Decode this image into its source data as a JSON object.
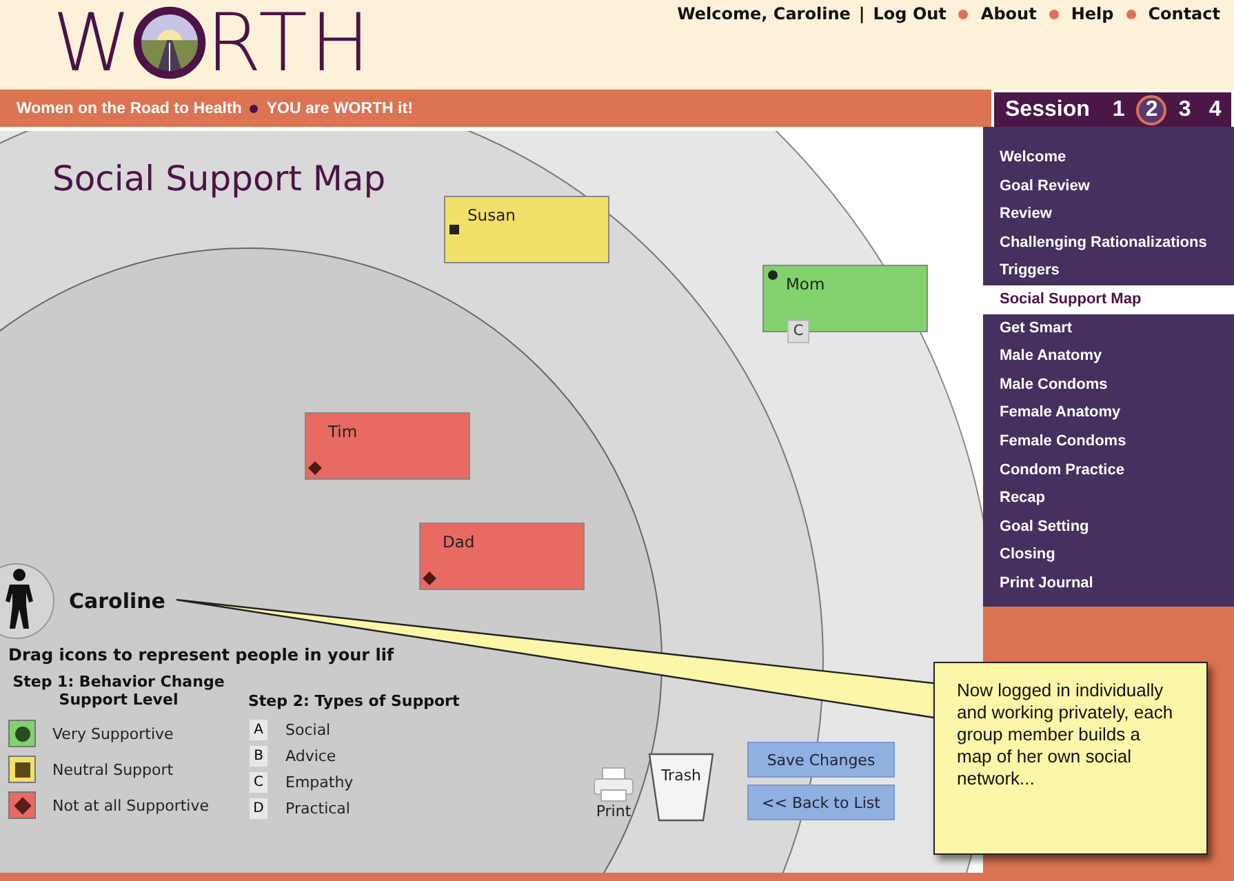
{
  "logo": {
    "before": "W",
    "after": "RTH"
  },
  "top_links": [
    {
      "kind": "text",
      "label": "Welcome, Caroline"
    },
    {
      "kind": "sep",
      "label": "|"
    },
    {
      "kind": "link",
      "label": "Log Out"
    },
    {
      "kind": "link",
      "label": "About"
    },
    {
      "kind": "link",
      "label": "Help"
    },
    {
      "kind": "link",
      "label": "Contact"
    }
  ],
  "tagline": [
    "Women on the Road to Health",
    "YOU are WORTH it!"
  ],
  "session": {
    "label": "Session",
    "numbers": [
      {
        "label": "1",
        "selected": false
      },
      {
        "label": "2",
        "selected": true
      },
      {
        "label": "3",
        "selected": false
      },
      {
        "label": "4",
        "selected": false
      }
    ]
  },
  "page_title": "Social Support Map",
  "people": [
    {
      "name": "Susan",
      "kind": "neutral"
    },
    {
      "name": "Mom",
      "kind": "very",
      "tags": [
        "C"
      ]
    },
    {
      "name": "Tim",
      "kind": "not"
    },
    {
      "name": "Dad",
      "kind": "not"
    }
  ],
  "self_name": "Caroline",
  "instruction": "Drag icons to represent people in your lif",
  "step1": {
    "title": "Step 1: Behavior Change Support Level",
    "items": [
      {
        "kind": "very",
        "label": "Very Supportive"
      },
      {
        "kind": "neutral",
        "label": "Neutral Support"
      },
      {
        "kind": "not",
        "label": "Not at all Supportive"
      }
    ]
  },
  "step2": {
    "title": "Step 2: Types of Support",
    "items": [
      {
        "letter": "A",
        "label": "Social"
      },
      {
        "letter": "B",
        "label": "Advice"
      },
      {
        "letter": "C",
        "label": "Empathy"
      },
      {
        "letter": "D",
        "label": "Practical"
      }
    ]
  },
  "print_label": "Print",
  "trash_label": "Trash",
  "buttons": [
    "Save Changes",
    "<< Back to List"
  ],
  "sidebar": {
    "items": [
      {
        "label": "Welcome",
        "selected": false
      },
      {
        "label": "Goal Review",
        "selected": false
      },
      {
        "label": "Review",
        "selected": false
      },
      {
        "label": "Challenging Rationalizations",
        "selected": false
      },
      {
        "label": "Triggers",
        "selected": false
      },
      {
        "label": "Social Support Map",
        "selected": true
      },
      {
        "label": "Get Smart",
        "selected": false
      },
      {
        "label": "Male Anatomy",
        "selected": false
      },
      {
        "label": "Male Condoms",
        "selected": false
      },
      {
        "label": "Female Anatomy",
        "selected": false
      },
      {
        "label": "Female Condoms",
        "selected": false
      },
      {
        "label": "Condom Practice",
        "selected": false
      },
      {
        "label": "Recap",
        "selected": false
      },
      {
        "label": "Goal Setting",
        "selected": false
      },
      {
        "label": "Closing",
        "selected": false
      },
      {
        "label": "Print Journal",
        "selected": false
      }
    ]
  },
  "callout": "Now logged in individually and working privately, each group member builds a map of her own social network..."
}
